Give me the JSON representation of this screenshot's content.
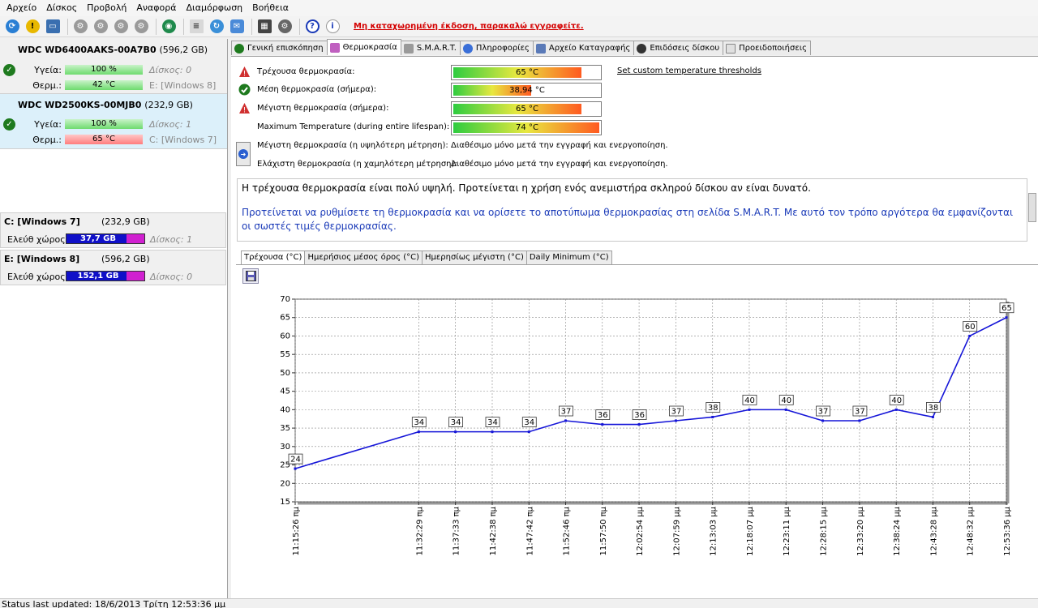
{
  "menu": [
    "Αρχείο",
    "Δίσκος",
    "Προβολή",
    "Αναφορά",
    "Διαμόρφωση",
    "Βοήθεια"
  ],
  "toolbar": {
    "registration_notice": "Μη καταχωρημένη έκδοση, παρακαλώ εγγραφείτε.",
    "buttons": [
      "refresh-icon",
      "warning-icon",
      "disk-image-icon",
      "drive-tool-1-icon",
      "drive-tool-2-icon",
      "drive-tool-3-icon",
      "drive-tool-4-icon",
      "globe-icon",
      "report-icon",
      "sync-icon",
      "chat-icon",
      "benchmark-icon",
      "gear-icon",
      "help-icon",
      "info-icon"
    ]
  },
  "disks": [
    {
      "title": "WDC WD6400AAKS-00A7B0",
      "size": "(596,2 GB)",
      "health_label": "Υγεία:",
      "health": "100 %",
      "disk_label": "Δίσκος: 0",
      "temp_label": "Θερμ.:",
      "temp": "42 °C",
      "volumes": "E: [Windows 8]",
      "temp_status": "green"
    },
    {
      "title": "WDC WD2500KS-00MJB0",
      "size": "(232,9 GB)",
      "health_label": "Υγεία:",
      "health": "100 %",
      "disk_label": "Δίσκος: 1",
      "temp_label": "Θερμ.:",
      "temp": "65 °C",
      "volumes": "C: [Windows 7]",
      "temp_status": "red"
    }
  ],
  "volumes": [
    {
      "name": "C: [Windows 7]",
      "size": "(232,9 GB)",
      "free_label": "Ελεύθ χώρος",
      "free": "37,7 GB",
      "disk": "Δίσκος: 1",
      "free_fraction": 0.16
    },
    {
      "name": "E: [Windows 8]",
      "size": "(596,2 GB)",
      "free_label": "Ελεύθ χώρος",
      "free": "152,1 GB",
      "disk": "Δίσκος: 0",
      "free_fraction": 0.26
    }
  ],
  "tabs": [
    "Γενική επισκόπηση",
    "Θερμοκρασία",
    "S.M.A.R.T.",
    "Πληροφορίες",
    "Αρχείο Καταγραφής",
    "Επιδόσεις δίσκου",
    "Προειδοποιήσεις"
  ],
  "temperature": {
    "set_thresholds": "Set custom temperature thresholds",
    "rows": [
      {
        "icon": "warning",
        "label": "Τρέχουσα θερμοκρασία:",
        "value": "65 °C",
        "fraction": 0.87
      },
      {
        "icon": "ok",
        "label": "Μέση θερμοκρασία (σήμερα):",
        "value": "38,94 °C",
        "fraction": 0.52
      },
      {
        "icon": "warning",
        "label": "Μέγιστη θερμοκρασία (σήμερα):",
        "value": "65 °C",
        "fraction": 0.87
      },
      {
        "icon": "none",
        "label": "Maximum Temperature (during entire lifespan):",
        "value": "74 °C",
        "fraction": 0.98
      }
    ],
    "unavailable_rows": [
      {
        "label": "Μέγιστη θερμοκρασία (η υψηλότερη μέτρηση):",
        "value": "Διαθέσιμο μόνο μετά την εγγραφή και ενεργοποίηση."
      },
      {
        "label": "Ελάχιστη θερμοκρασία (η χαμηλότερη μέτρηση):",
        "value": "Διαθέσιμο μόνο μετά την εγγραφή και ενεργοποίηση."
      }
    ],
    "advice_1": "Η τρέχουσα θερμοκρασία είναι πολύ υψηλή. Προτείνεται η χρήση ενός ανεμιστήρα σκληρού δίσκου αν είναι δυνατό.",
    "advice_2": "Προτείνεται να ρυθμίσετε τη θερμοκρασία και να ορίσετε το αποτύπωμα θερμοκρασίας στη σελίδα S.M.A.R.T. Με αυτό τον τρόπο αργότερα θα εμφανίζονται οι σωστές τιμές θερμοκρασίας."
  },
  "chart_tabs": [
    "Τρέχουσα (°C)",
    "Ημερήσιος μέσος όρος (°C)",
    "Ημερησίως μέγιστη (°C)",
    "Daily Minimum (°C)"
  ],
  "chart_data": {
    "type": "line",
    "x": [
      "11:15:26 πμ",
      "11:32:29 πμ",
      "11:37:33 πμ",
      "11:42:38 πμ",
      "11:47:42 πμ",
      "11:52:46 πμ",
      "11:57:50 πμ",
      "12:02:54 μμ",
      "12:07:59 μμ",
      "12:13:03 μμ",
      "12:18:07 μμ",
      "12:23:11 μμ",
      "12:28:15 μμ",
      "12:33:20 μμ",
      "12:38:24 μμ",
      "12:43:28 μμ",
      "12:48:32 μμ",
      "12:53:36 μμ"
    ],
    "x_minutes": [
      0,
      17.05,
      22.12,
      27.2,
      32.27,
      37.33,
      42.4,
      47.47,
      52.55,
      57.62,
      62.68,
      67.75,
      72.82,
      77.9,
      82.97,
      88.03,
      93.1,
      98.17
    ],
    "values": [
      24,
      34,
      34,
      34,
      34,
      37,
      36,
      36,
      37,
      38,
      40,
      40,
      37,
      37,
      40,
      38,
      60,
      65
    ],
    "ylim": [
      15,
      70
    ],
    "yticks": [
      15,
      20,
      25,
      30,
      35,
      40,
      45,
      50,
      55,
      60,
      65,
      70
    ],
    "grid": true,
    "line_color": "#1515d8"
  },
  "status": "Status last updated: 18/6/2013 Τρίτη 12:53:36 μμ"
}
